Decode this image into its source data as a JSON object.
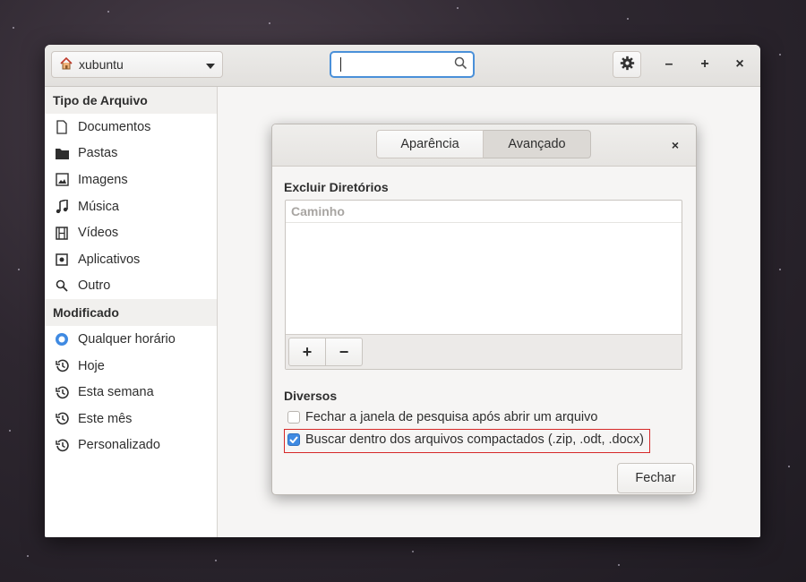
{
  "window": {
    "location_label": "xubuntu",
    "search_value": "",
    "icons": {
      "location": "home-icon",
      "dropdown": "chevron-down-icon",
      "search": "search-icon",
      "settings": "gear-icon"
    },
    "controls": {
      "minimize": "–",
      "maximize": "+",
      "close": "×"
    }
  },
  "sidebar": {
    "file_type_title": "Tipo de Arquivo",
    "file_types": [
      {
        "label": "Documentos",
        "icon": "document-icon"
      },
      {
        "label": "Pastas",
        "icon": "folder-icon"
      },
      {
        "label": "Imagens",
        "icon": "image-icon"
      },
      {
        "label": "Música",
        "icon": "music-icon"
      },
      {
        "label": "Vídeos",
        "icon": "video-icon"
      },
      {
        "label": "Aplicativos",
        "icon": "application-icon"
      },
      {
        "label": "Outro",
        "icon": "search-icon"
      }
    ],
    "modified_title": "Modificado",
    "modified": [
      {
        "label": "Qualquer horário",
        "icon": "radio-selected-icon"
      },
      {
        "label": "Hoje",
        "icon": "history-icon"
      },
      {
        "label": "Esta semana",
        "icon": "history-icon"
      },
      {
        "label": "Este mês",
        "icon": "history-icon"
      },
      {
        "label": "Personalizado",
        "icon": "history-icon"
      }
    ]
  },
  "dialog": {
    "tabs": [
      {
        "label": "Aparência",
        "active": false
      },
      {
        "label": "Avançado",
        "active": true
      }
    ],
    "close_icon": "×",
    "exclude_title": "Excluir Diretórios",
    "column_header": "Caminho",
    "add_label": "+",
    "remove_label": "−",
    "misc_title": "Diversos",
    "options": [
      {
        "label": "Fechar a janela de pesquisa após abrir um arquivo",
        "checked": false
      },
      {
        "label": "Buscar dentro dos arquivos compactados (.zip, .odt, .docx)",
        "checked": true
      }
    ],
    "close_button": "Fechar"
  },
  "colors": {
    "accent": "#3f8ae2",
    "highlight_border": "#d62828"
  }
}
